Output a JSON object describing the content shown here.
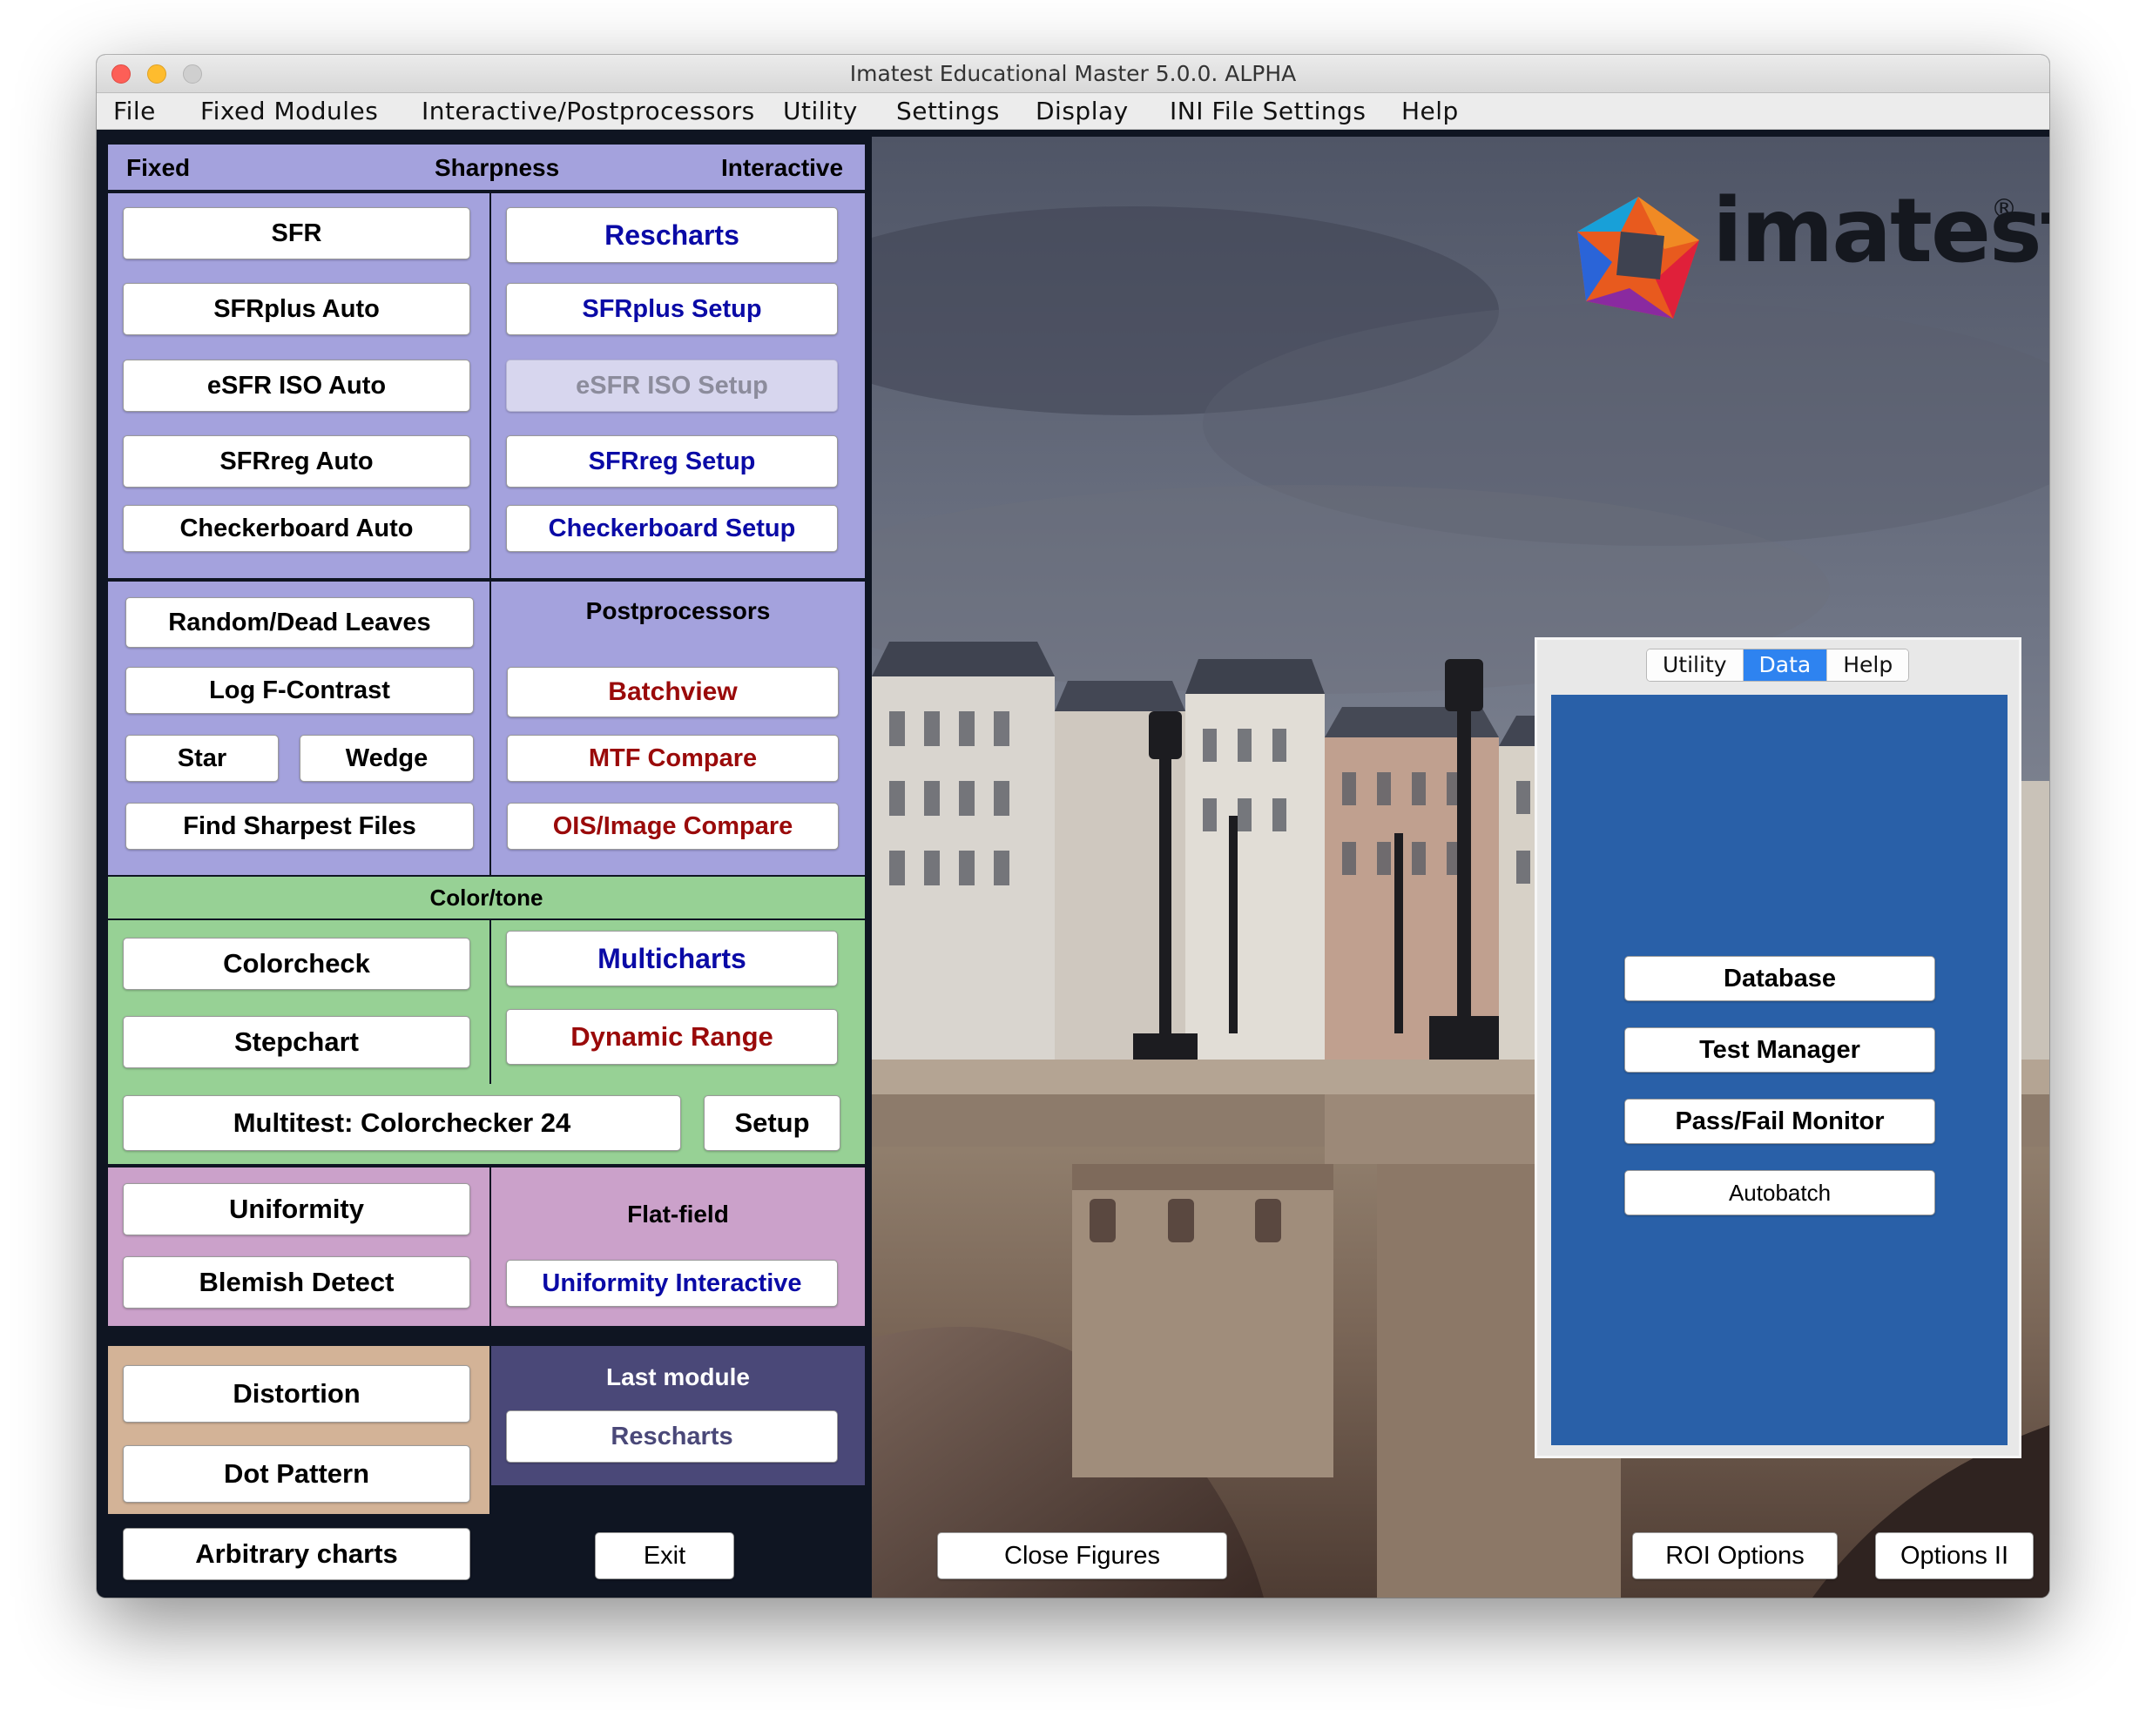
{
  "window": {
    "title": "Imatest Educational Master 5.0.0. ALPHA"
  },
  "menu": [
    "File",
    "Fixed Modules",
    "Interactive/Postprocessors",
    "Utility",
    "Settings",
    "Display",
    "INI File Settings",
    "Help"
  ],
  "sharpness": {
    "header_fixed": "Fixed",
    "header_title": "Sharpness",
    "header_interactive": "Interactive",
    "fixed_buttons": [
      "SFR",
      "SFRplus Auto",
      "eSFR ISO Auto",
      "SFRreg Auto",
      "Checkerboard Auto"
    ],
    "interactive_buttons": [
      "Rescharts",
      "SFRplus Setup",
      "eSFR ISO Setup",
      "SFRreg Setup",
      "Checkerboard Setup"
    ]
  },
  "misc": {
    "random_dead_leaves": "Random/Dead Leaves",
    "log_f_contrast": "Log F-Contrast",
    "star": "Star",
    "wedge": "Wedge",
    "find_sharpest": "Find Sharpest Files"
  },
  "postprocessors": {
    "title": "Postprocessors",
    "buttons": [
      "Batchview",
      "MTF Compare",
      "OIS/Image Compare"
    ]
  },
  "color": {
    "title": "Color/tone",
    "colorcheck": "Colorcheck",
    "stepchart": "Stepchart",
    "multicharts": "Multicharts",
    "dynamic_range": "Dynamic Range",
    "multitest": "Multitest:  Colorchecker 24",
    "setup": "Setup"
  },
  "uniformity": {
    "uniformity": "Uniformity",
    "blemish": "Blemish Detect",
    "flatfield_title": "Flat-field",
    "uniformity_interactive": "Uniformity Interactive"
  },
  "distortion": {
    "distortion": "Distortion",
    "dot_pattern": "Dot Pattern"
  },
  "last_module": {
    "title": "Last module",
    "button": "Rescharts"
  },
  "bottom": {
    "arbitrary": "Arbitrary charts",
    "exit": "Exit",
    "close_figures": "Close Figures",
    "roi_options": "ROI Options",
    "options_ii": "Options II"
  },
  "logo": {
    "text": "imatest",
    "mark": "®"
  },
  "data_panel": {
    "tabs": [
      "Utility",
      "Data",
      "Help"
    ],
    "active_tab": "Data",
    "buttons": [
      "Database",
      "Test Manager",
      "Pass/Fail Monitor",
      "Autobatch"
    ]
  },
  "colors": {
    "purple": "#a4a2dd",
    "green": "#97d195",
    "pink": "#cba1ca",
    "tan": "#d3b397",
    "dark": "#4a4878",
    "blue_text": "#0a0aa6",
    "red_text": "#9a0a0a",
    "data_blue": "#2960a8"
  }
}
